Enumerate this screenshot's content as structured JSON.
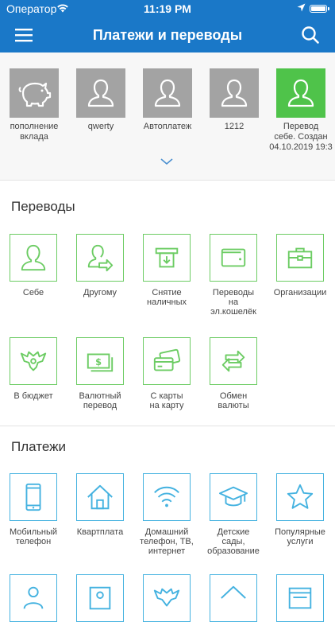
{
  "status_bar": {
    "carrier": "Оператор",
    "time": "11:19 PM"
  },
  "header": {
    "title": "Платежи и переводы"
  },
  "recent": {
    "items": [
      {
        "label": "пополнение\nвклада",
        "icon": "piggy-bank-icon"
      },
      {
        "label": "qwerty",
        "icon": "user-icon"
      },
      {
        "label": "Автоплатеж",
        "icon": "user-icon"
      },
      {
        "label": "1212",
        "icon": "user-icon"
      },
      {
        "label": "Перевод\nсебе. Создан\n04.10.2019 19:3",
        "icon": "user-icon"
      }
    ]
  },
  "transfers": {
    "title": "Переводы",
    "items": [
      {
        "label": "Себе",
        "icon": "user-icon"
      },
      {
        "label": "Другому",
        "icon": "user-transfer-icon"
      },
      {
        "label": "Снятие\nналичных",
        "icon": "atm-icon"
      },
      {
        "label": "Переводы\nна\nэл.кошелёк",
        "icon": "wallet-icon"
      },
      {
        "label": "Организации",
        "icon": "briefcase-icon"
      },
      {
        "label": "В бюджет",
        "icon": "emblem-icon"
      },
      {
        "label": "Валютный\nперевод",
        "icon": "banknote-icon"
      },
      {
        "label": "С карты\nна карту",
        "icon": "cards-icon"
      },
      {
        "label": "Обмен\nвалюты",
        "icon": "exchange-icon"
      }
    ]
  },
  "payments": {
    "title": "Платежи",
    "items": [
      {
        "label": "Мобильный\nтелефон",
        "icon": "mobile-phone-icon"
      },
      {
        "label": "Квартплата",
        "icon": "house-icon"
      },
      {
        "label": "Домашний\nтелефон, ТВ,\nинтернет",
        "icon": "wifi-icon"
      },
      {
        "label": "Детские\nсады,\nобразование",
        "icon": "graduation-cap-icon"
      },
      {
        "label": "Популярные\nуслуги",
        "icon": "star-icon"
      }
    ]
  },
  "colors": {
    "brand": "#1a78c8",
    "transfers_accent": "#6ccc63",
    "payments_accent": "#44b2e0",
    "recent_tile": "#a3a3a3",
    "recent_tile_active": "#4fc34a"
  }
}
